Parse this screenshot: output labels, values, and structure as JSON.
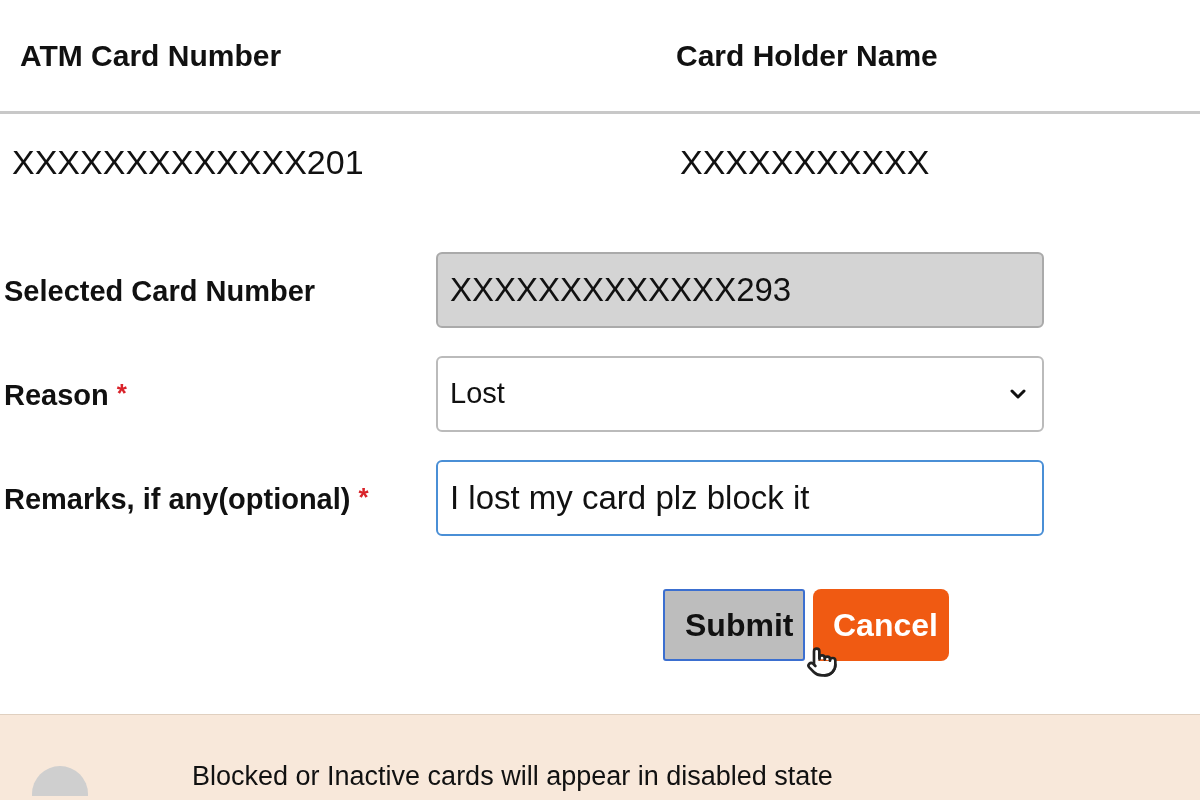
{
  "card_table": {
    "columns": [
      "ATM Card Number",
      "Card Holder Name"
    ],
    "row": [
      "XXXXXXXXXXXXX201",
      "XXXXXXXXXXX"
    ]
  },
  "form": {
    "fields": [
      {
        "kind": "readonly",
        "label": "Selected Card Number",
        "value": "XXXXXXXXXXXXX293"
      },
      {
        "kind": "select",
        "label": "Reason",
        "required_mark": "*",
        "value": "Lost"
      },
      {
        "kind": "text",
        "label": "Remarks, if any(optional)",
        "required_mark": "*",
        "value": "I lost my card plz block it",
        "focused": true
      }
    ],
    "buttons": [
      {
        "label": "Submit",
        "kind": "primary"
      },
      {
        "label": "Cancel",
        "kind": "danger"
      }
    ]
  },
  "note": {
    "text": "Blocked or Inactive cards will appear in disabled state"
  }
}
